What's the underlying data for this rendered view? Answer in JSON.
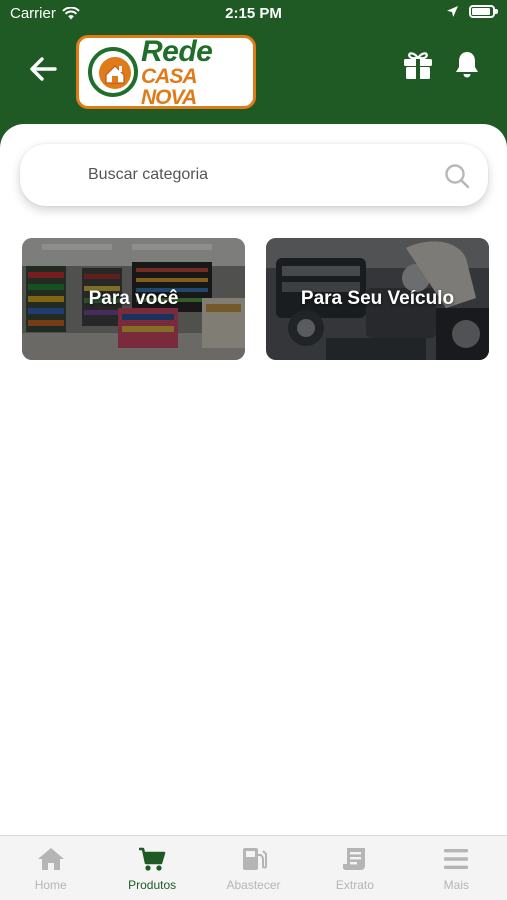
{
  "status_bar": {
    "carrier": "Carrier",
    "time": "2:15 PM",
    "battery_level": 0.9
  },
  "header": {
    "logo": {
      "line1": "Rede",
      "line2": "CASA NOVA"
    },
    "icons": {
      "back": "arrow-left-icon",
      "gift": "gift-icon",
      "bell": "bell-icon"
    }
  },
  "search": {
    "placeholder": "Buscar categoria",
    "value": ""
  },
  "categories": [
    {
      "label": "Para você"
    },
    {
      "label": "Para Seu Veículo"
    }
  ],
  "tabbar": {
    "active": "Produtos",
    "tabs": [
      {
        "label": "Home",
        "icon": "home-icon"
      },
      {
        "label": "Produtos",
        "icon": "cart-icon"
      },
      {
        "label": "Abastecer",
        "icon": "fuel-pump-icon"
      },
      {
        "label": "Extrato",
        "icon": "receipt-icon"
      },
      {
        "label": "Mais",
        "icon": "menu-icon"
      }
    ]
  },
  "colors": {
    "primary_green": "#1f5a24",
    "brand_orange": "#e07b1a",
    "inactive_tab": "#b5b5b5"
  }
}
